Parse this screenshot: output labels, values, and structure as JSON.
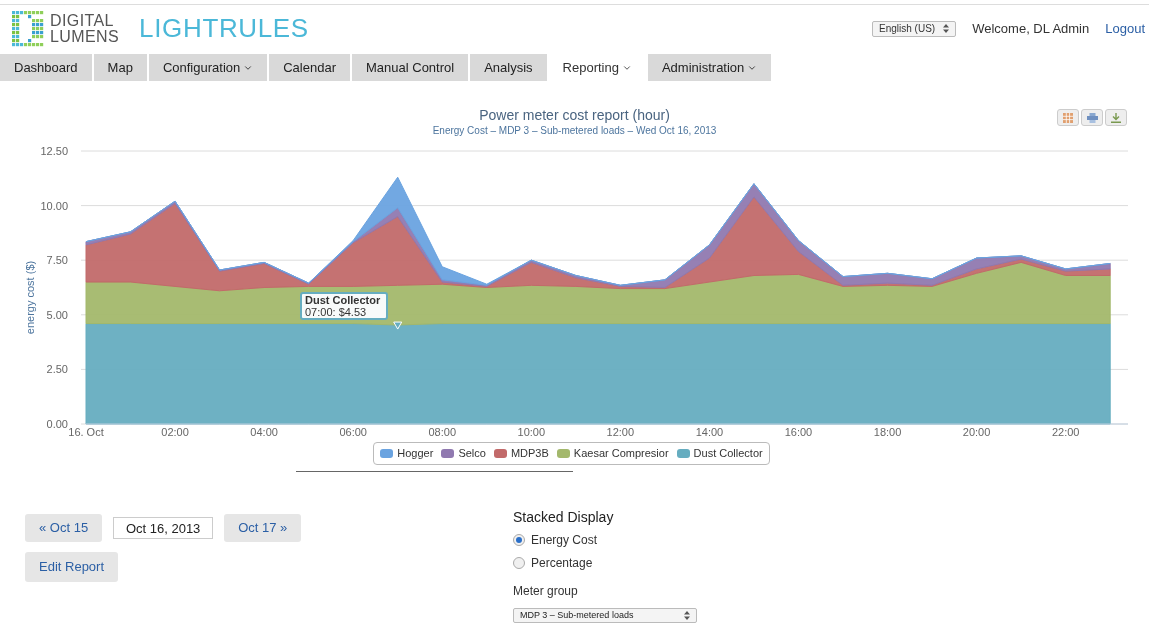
{
  "header": {
    "logo": {
      "line1": "DIGITAL",
      "line2": "LUMENS",
      "product": "LIGHTRULES"
    },
    "language": "English (US)",
    "welcome": "Welcome, DL Admin",
    "logout": "Logout"
  },
  "nav": [
    {
      "label": "Dashboard",
      "selected": false,
      "dropdown": false
    },
    {
      "label": "Map",
      "selected": false,
      "dropdown": false
    },
    {
      "label": "Configuration",
      "selected": false,
      "dropdown": true
    },
    {
      "label": "Calendar",
      "selected": false,
      "dropdown": false
    },
    {
      "label": "Manual Control",
      "selected": false,
      "dropdown": false
    },
    {
      "label": "Analysis",
      "selected": false,
      "dropdown": false
    },
    {
      "label": "Reporting",
      "selected": true,
      "dropdown": true
    },
    {
      "label": "Administration",
      "selected": false,
      "dropdown": true
    }
  ],
  "report": {
    "title": "Power meter cost report (hour)",
    "subtitle": "Energy Cost – MDP 3 – Sub-metered loads – Wed Oct 16, 2013",
    "chart_data": {
      "type": "area",
      "stacked": true,
      "ylabel": "energy cost ($)",
      "x": [
        0,
        1,
        2,
        3,
        4,
        5,
        6,
        7,
        8,
        9,
        10,
        11,
        12,
        13,
        14,
        15,
        16,
        17,
        18,
        19,
        20,
        21,
        22,
        23
      ],
      "series": [
        {
          "name": "Hogger",
          "color": "#6aa3e0",
          "values": [
            0,
            0,
            0,
            0,
            0,
            0,
            0.05,
            1.4,
            0.6,
            0.05,
            0,
            0,
            0,
            0,
            0,
            0,
            0,
            0,
            0,
            0,
            0,
            0,
            0,
            0
          ]
        },
        {
          "name": "Selco",
          "color": "#9079b0",
          "values": [
            0.15,
            0.1,
            0.1,
            0.05,
            0.05,
            0.05,
            0.05,
            0.4,
            0.1,
            0.05,
            0.1,
            0.1,
            0.05,
            0.35,
            0.6,
            0.6,
            0.5,
            0.4,
            0.45,
            0.3,
            0.5,
            0.15,
            0.1,
            0.25
          ]
        },
        {
          "name": "MDP3B",
          "color": "#c26a6a",
          "values": [
            1.7,
            2.2,
            3.8,
            0.9,
            1.1,
            0.1,
            2.0,
            3.15,
            0.1,
            0.05,
            1.05,
            0.4,
            0.1,
            0.05,
            1.1,
            3.6,
            1.05,
            0.05,
            0.1,
            0.05,
            0.2,
            0.15,
            0.2,
            0.3
          ]
        },
        {
          "name": "Kaesar Compresior",
          "color": "#a3b86c",
          "values": [
            1.9,
            1.9,
            1.7,
            1.5,
            1.65,
            1.7,
            1.7,
            1.82,
            1.8,
            1.65,
            1.75,
            1.7,
            1.6,
            1.6,
            1.9,
            2.2,
            2.25,
            1.7,
            1.75,
            1.7,
            2.3,
            2.8,
            2.2,
            2.2
          ]
        },
        {
          "name": "Dust Collector",
          "color": "#66adc0",
          "values": [
            4.6,
            4.6,
            4.6,
            4.6,
            4.6,
            4.6,
            4.6,
            4.53,
            4.6,
            4.6,
            4.6,
            4.6,
            4.6,
            4.6,
            4.6,
            4.6,
            4.6,
            4.6,
            4.6,
            4.6,
            4.6,
            4.6,
            4.6,
            4.6
          ]
        }
      ],
      "ylim": [
        0,
        12.5
      ],
      "xlim": [
        0,
        23.4
      ],
      "grid": true,
      "yticks": [
        {
          "value": 0,
          "label": "0.00"
        },
        {
          "value": 2.5,
          "label": "2.50"
        },
        {
          "value": 5,
          "label": "5.00"
        },
        {
          "value": 7.5,
          "label": "7.50"
        },
        {
          "value": 10,
          "label": "10.00"
        },
        {
          "value": 12.5,
          "label": "12.50"
        }
      ],
      "xticks": [
        {
          "value": 0,
          "label": "16. Oct"
        },
        {
          "value": 2,
          "label": "02:00"
        },
        {
          "value": 4,
          "label": "04:00"
        },
        {
          "value": 6,
          "label": "06:00"
        },
        {
          "value": 8,
          "label": "08:00"
        },
        {
          "value": 10,
          "label": "10:00"
        },
        {
          "value": 12,
          "label": "12:00"
        },
        {
          "value": 14,
          "label": "14:00"
        },
        {
          "value": 16,
          "label": "16:00"
        },
        {
          "value": 18,
          "label": "18:00"
        },
        {
          "value": 20,
          "label": "20:00"
        },
        {
          "value": 22,
          "label": "22:00"
        }
      ]
    },
    "tooltip": {
      "title": "Dust Collector",
      "text": "07:00: $4.53"
    }
  },
  "controls": {
    "prev": "« Oct 15",
    "date": "Oct 16, 2013",
    "next": "Oct 17 »",
    "edit": "Edit Report"
  },
  "display": {
    "heading": "Stacked Display",
    "options": [
      {
        "label": "Energy Cost",
        "selected": true
      },
      {
        "label": "Percentage",
        "selected": false
      }
    ],
    "meter_label": "Meter group",
    "meter_value": "MDP 3 – Sub-metered loads"
  }
}
